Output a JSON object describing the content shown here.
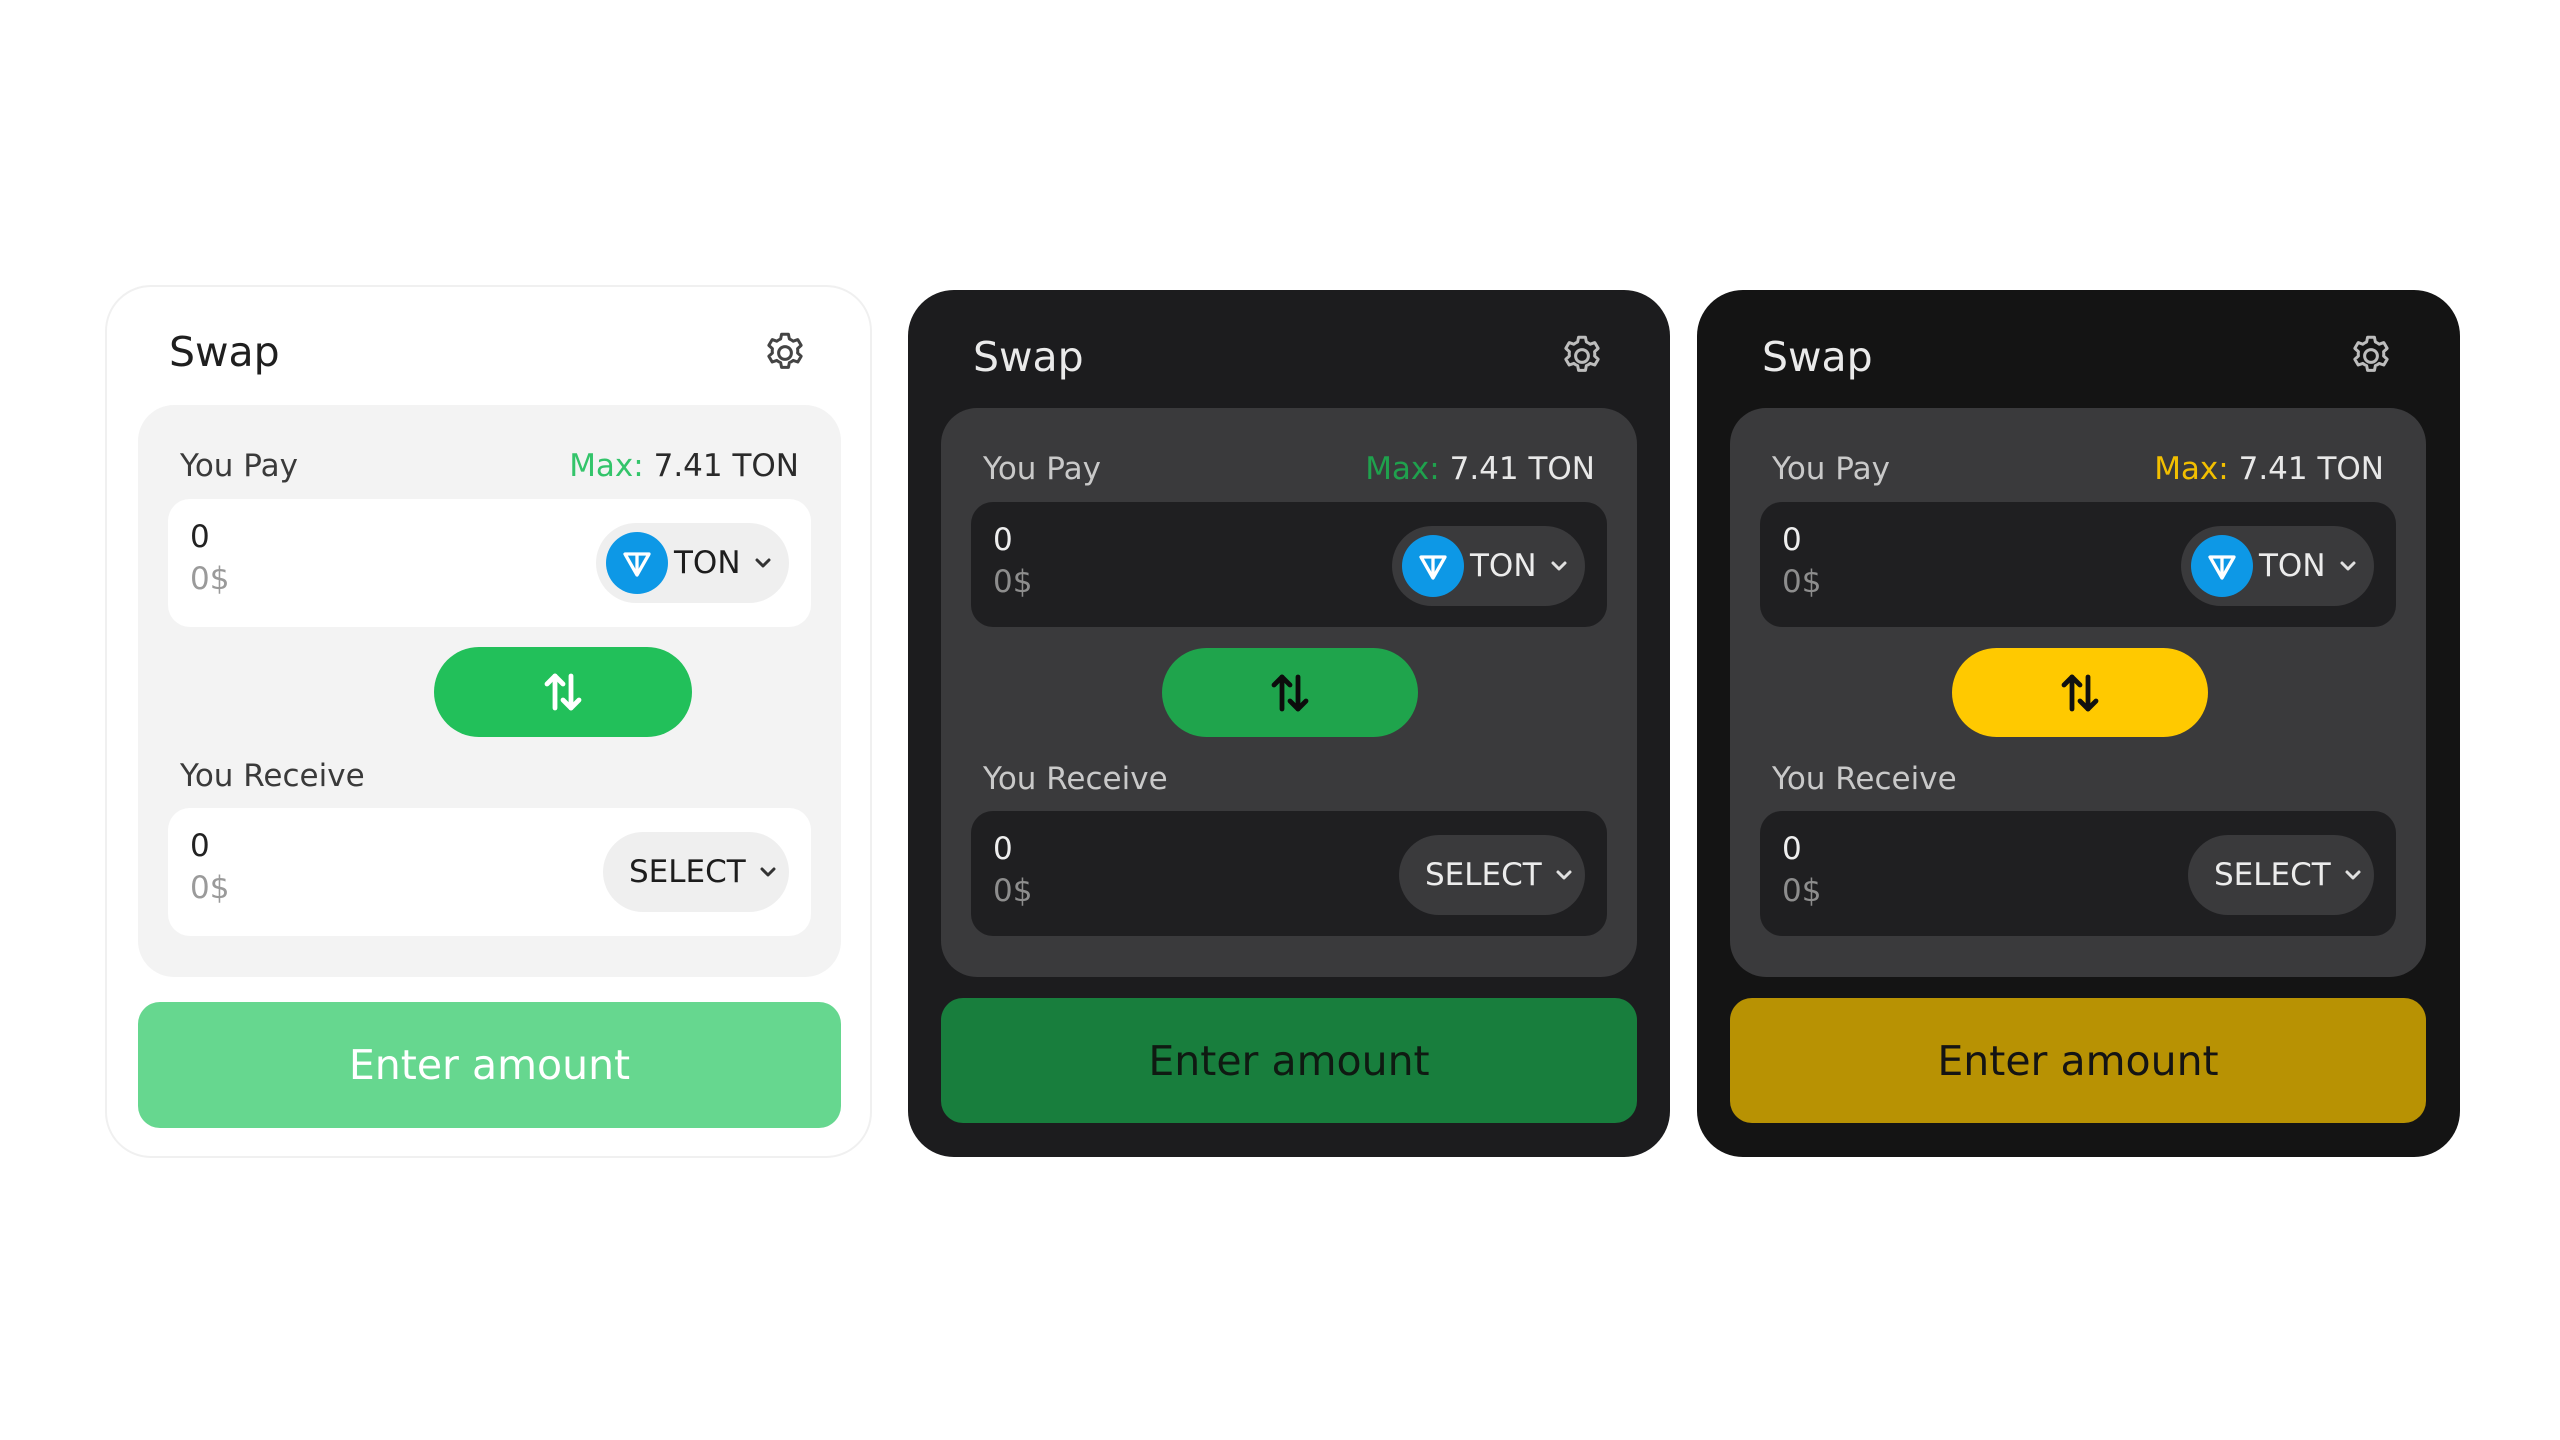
{
  "cards": [
    {
      "theme": "light",
      "title": "Swap",
      "pay_label": "You Pay",
      "max_key": "Max:",
      "max_value": "7.41 TON",
      "pay_amount": "0",
      "pay_usd": "0$",
      "pay_token": "TON",
      "receive_label": "You Receive",
      "receive_amount": "0",
      "receive_usd": "0$",
      "receive_token": "SELECT",
      "cta_label": "Enter amount",
      "icons": {
        "settings": "gear-icon",
        "swap": "swap-arrows-icon",
        "token": "ton-logo-icon",
        "dropdown": "chevron-down-icon"
      },
      "colors": {
        "accent": "#22c05a",
        "cta": "#66d78f",
        "max": "#33c46a"
      }
    },
    {
      "theme": "dark",
      "title": "Swap",
      "pay_label": "You Pay",
      "max_key": "Max:",
      "max_value": "7.41 TON",
      "pay_amount": "0",
      "pay_usd": "0$",
      "pay_token": "TON",
      "receive_label": "You Receive",
      "receive_amount": "0",
      "receive_usd": "0$",
      "receive_token": "SELECT",
      "cta_label": "Enter amount",
      "icons": {
        "settings": "gear-icon",
        "swap": "swap-arrows-icon",
        "token": "ton-logo-icon",
        "dropdown": "chevron-down-icon"
      },
      "colors": {
        "accent": "#1fa44c",
        "cta": "#187e3d",
        "max": "#1fa14d"
      }
    },
    {
      "theme": "gold",
      "title": "Swap",
      "pay_label": "You Pay",
      "max_key": "Max:",
      "max_value": "7.41 TON",
      "pay_amount": "0",
      "pay_usd": "0$",
      "pay_token": "TON",
      "receive_label": "You Receive",
      "receive_amount": "0",
      "receive_usd": "0$",
      "receive_token": "SELECT",
      "cta_label": "Enter amount",
      "icons": {
        "settings": "gear-icon",
        "swap": "swap-arrows-icon",
        "token": "ton-logo-icon",
        "dropdown": "chevron-down-icon"
      },
      "colors": {
        "accent": "#ffc900",
        "cta": "#b89203",
        "max": "#f2bf00"
      }
    }
  ]
}
